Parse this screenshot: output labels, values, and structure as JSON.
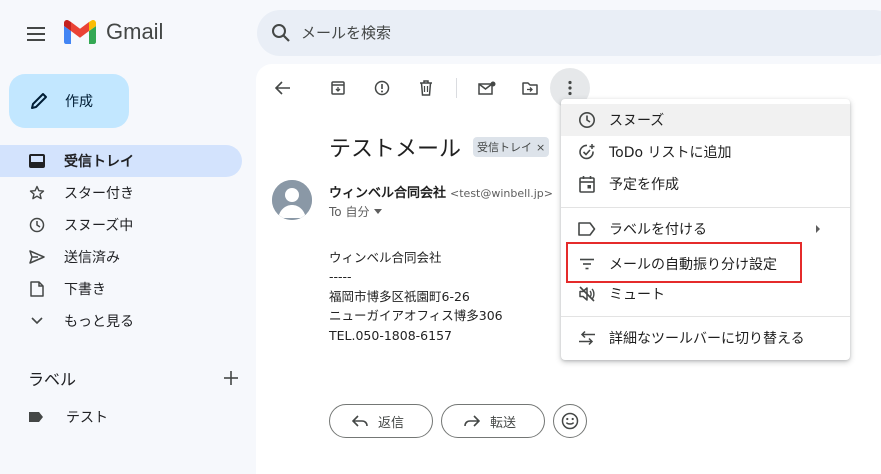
{
  "app": {
    "name": "Gmail"
  },
  "search": {
    "placeholder": "メールを検索"
  },
  "sidebar": {
    "compose_label": "作成",
    "items": [
      {
        "label": "受信トレイ",
        "icon": "inbox-icon",
        "active": true
      },
      {
        "label": "スター付き",
        "icon": "star-icon"
      },
      {
        "label": "スヌーズ中",
        "icon": "clock-icon"
      },
      {
        "label": "送信済み",
        "icon": "send-icon"
      },
      {
        "label": "下書き",
        "icon": "draft-icon"
      },
      {
        "label": "もっと見る",
        "icon": "chevron-down-icon"
      }
    ],
    "labels_title": "ラベル",
    "labels": [
      {
        "label": "テスト",
        "icon": "label-icon"
      }
    ]
  },
  "email": {
    "subject": "テストメール",
    "chip_label": "受信トレイ",
    "chip_close": "×",
    "sender_name": "ウィンベル合同会社",
    "sender_email": "<test@winbell.jp>",
    "to": "To 自分",
    "body": [
      "ウィンベル合同会社",
      "-----",
      "福岡市博多区祇園町6-26",
      "ニューガイアオフィス博多306",
      "TEL.050-1808-6157"
    ],
    "reply_label": "返信",
    "forward_label": "転送"
  },
  "menu": {
    "items": [
      {
        "label": "スヌーズ",
        "icon": "clock-icon"
      },
      {
        "label": "ToDo リストに追加",
        "icon": "add-task-icon"
      },
      {
        "label": "予定を作成",
        "icon": "calendar-icon"
      },
      {
        "label": "ラベルを付ける",
        "icon": "label-outline-icon"
      },
      {
        "label": "メールの自動振り分け設定",
        "icon": "filter-icon"
      },
      {
        "label": "ミュート",
        "icon": "mute-icon"
      },
      {
        "label": "詳細なツールバーに切り替える",
        "icon": "swap-icon"
      }
    ]
  },
  "colors": {
    "highlight": "#e52b2b",
    "active_nav": "#d3e3fd",
    "compose": "#c2e7ff"
  }
}
